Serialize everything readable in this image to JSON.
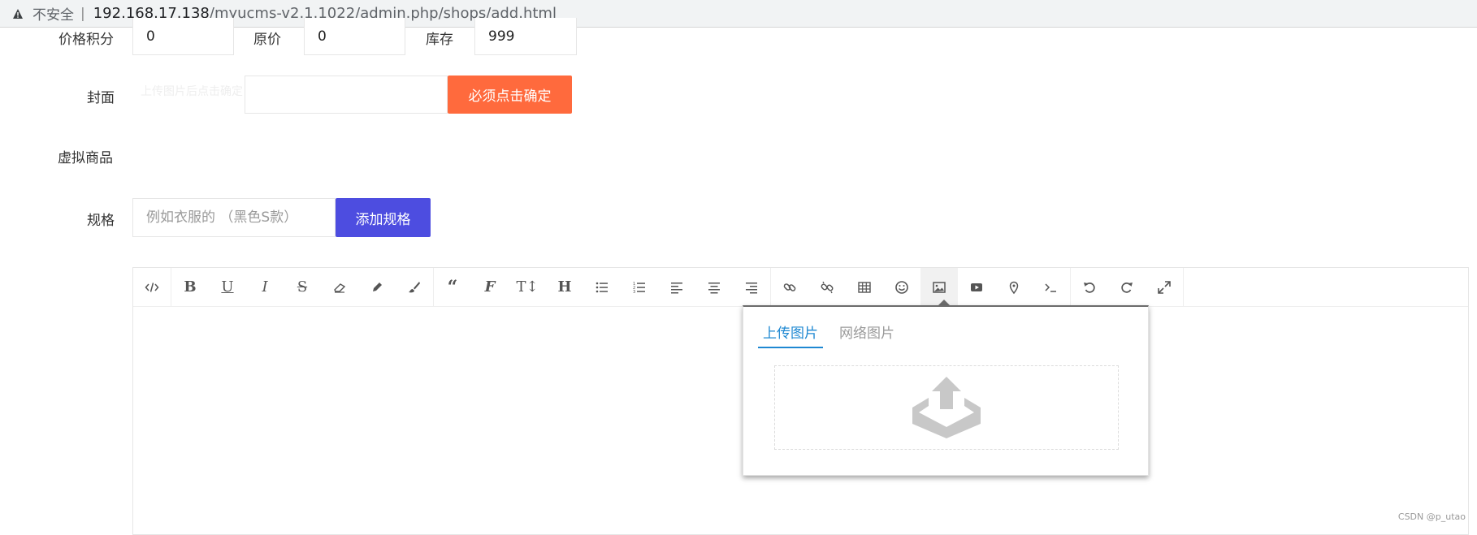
{
  "browser": {
    "insecure_label": "不安全",
    "separator": "|",
    "url_host": "192.168.17.138",
    "url_path": "/myucms-v2.1.1022/admin.php/shops/add.html"
  },
  "form": {
    "price_points_label": "价格积分",
    "price_points_value": "0",
    "original_price_label": "原价",
    "original_price_value": "0",
    "stock_label": "库存",
    "stock_value": "999",
    "cover_label": "封面",
    "cover_hint": "上传图片后点击确定",
    "cover_value": "",
    "cover_confirm_button": "必须点击确定",
    "virtual_label": "虚拟商品",
    "spec_label": "规格",
    "spec_placeholder": "例如衣服的 （黑色S款）",
    "add_spec_button": "添加规格"
  },
  "editor": {
    "toolbar_icons": [
      "code-view-icon",
      "bold-icon",
      "underline-icon",
      "italic-icon",
      "strikethrough-icon",
      "eraser-icon",
      "pencil-icon",
      "brush-icon",
      "quote-icon",
      "font-family-icon",
      "font-size-icon",
      "heading-icon",
      "bullet-list-icon",
      "ordered-list-icon",
      "align-left-icon",
      "align-center-icon",
      "align-right-icon",
      "link-icon",
      "unlink-icon",
      "table-icon",
      "emoji-icon",
      "image-icon",
      "video-icon",
      "location-icon",
      "terminal-icon",
      "undo-icon",
      "redo-icon",
      "fullscreen-icon"
    ],
    "image_popover": {
      "tab_upload": "上传图片",
      "tab_network": "网络图片",
      "upload_icon": "upload-tray-icon"
    }
  },
  "watermark": "CSDN @p_utao",
  "colors": {
    "orange": "#ff6a3d",
    "blue": "#4d4de0",
    "active_tab": "#1e88d2"
  }
}
